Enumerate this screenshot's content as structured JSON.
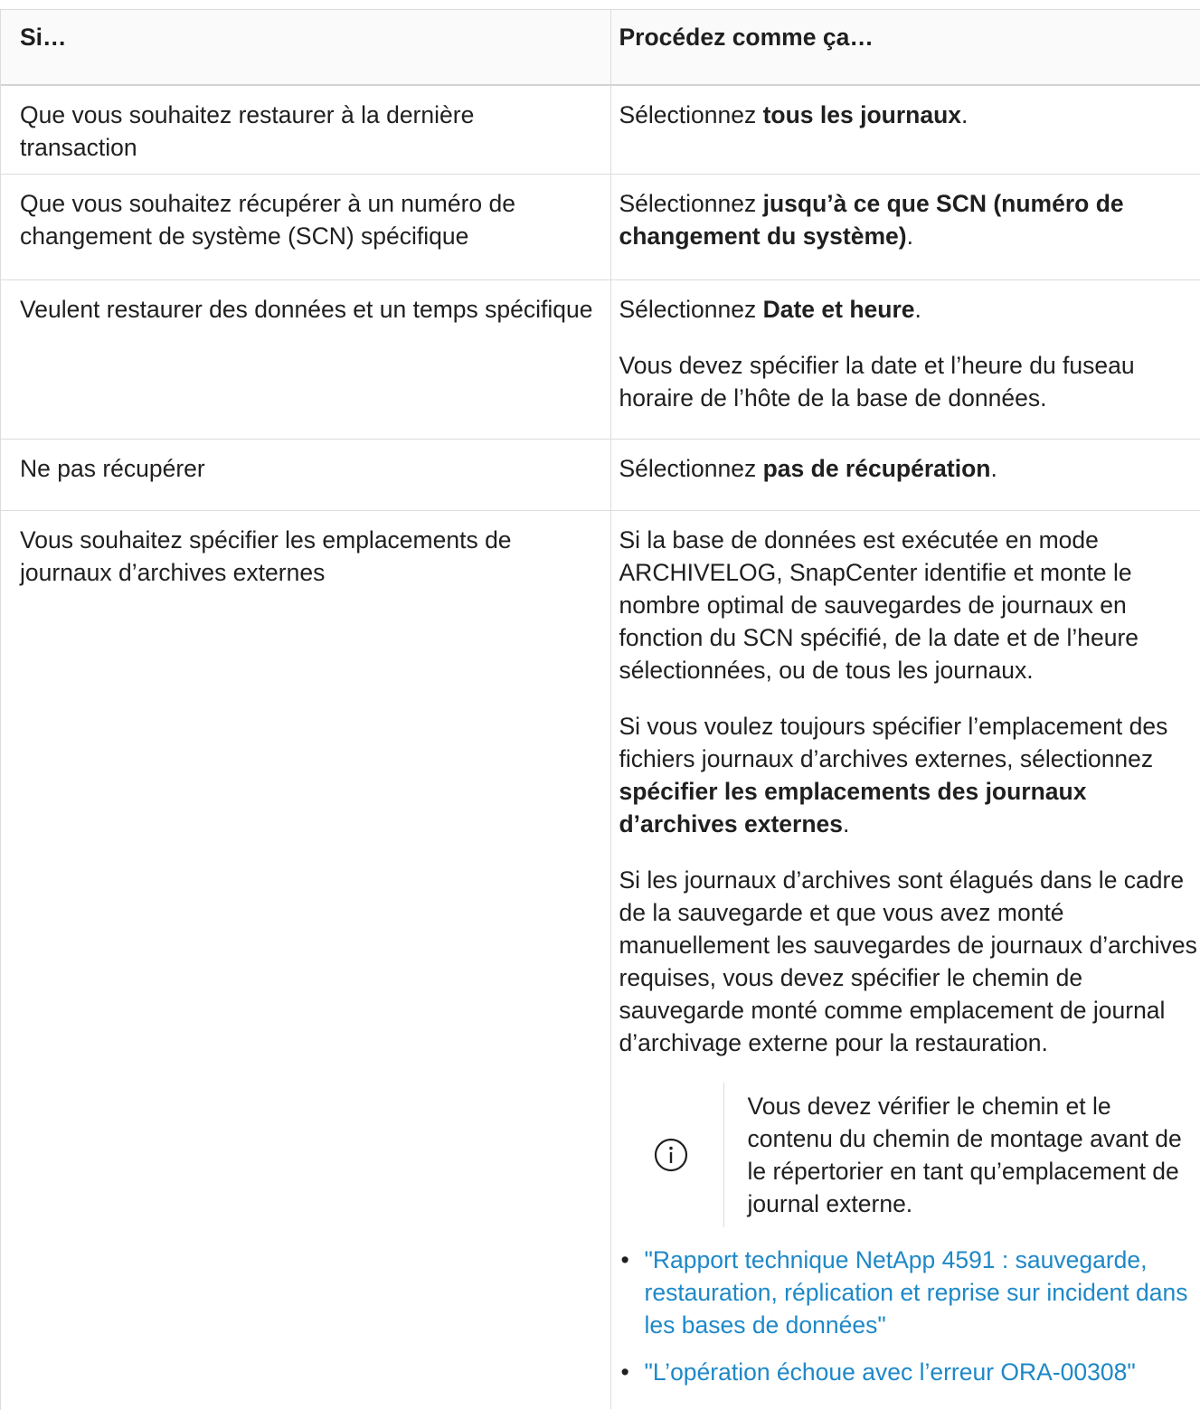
{
  "table": {
    "headers": [
      "Si…",
      "Procédez comme ça…"
    ],
    "rows": [
      {
        "condition": "Que vous souhaitez restaurer à la dernière transaction",
        "action_prefix": "Sélectionnez ",
        "action_bold": "tous les journaux",
        "action_suffix": "."
      },
      {
        "condition": "Que vous souhaitez récupérer à un numéro de changement de système (SCN) spécifique",
        "action_prefix": "Sélectionnez ",
        "action_bold": "jusqu’à ce que SCN (numéro de changement du système)",
        "action_suffix": "."
      },
      {
        "condition": "Veulent restaurer des données et un temps spécifique",
        "action_prefix": "Sélectionnez ",
        "action_bold": "Date et heure",
        "action_suffix": ".",
        "extra": "Vous devez spécifier la date et l’heure du fuseau horaire de l’hôte de la base de données."
      },
      {
        "condition": "Ne pas récupérer",
        "action_prefix": "Sélectionnez ",
        "action_bold": "pas de récupération",
        "action_suffix": "."
      },
      {
        "condition": "Vous souhaitez spécifier les emplacements de journaux d’archives externes",
        "para1": "Si la base de données est exécutée en mode ARCHIVELOG, SnapCenter identifie et monte le nombre optimal de sauvegardes de journaux en fonction du SCN spécifié, de la date et de l’heure sélectionnées, ou de tous les journaux.",
        "para2_prefix": "Si vous voulez toujours spécifier l’emplacement des fichiers journaux d’archives externes, sélectionnez ",
        "para2_bold": "spécifier les emplacements des journaux d’archives externes",
        "para2_suffix": ".",
        "para3": "Si les journaux d’archives sont élagués dans le cadre de la sauvegarde et que vous avez monté manuellement les sauvegardes de journaux d’archives requises, vous devez spécifier le chemin de sauvegarde monté comme emplacement de journal d’archivage externe pour la restauration.",
        "note": "Vous devez vérifier le chemin et le contenu du chemin de montage avant de le répertorier en tant qu’emplacement de journal externe.",
        "note_icon": "info-circle-icon",
        "links": [
          "\"Rapport technique NetApp 4591 : sauvegarde, restauration, réplication et reprise sur incident dans les bases de données\"",
          "\"L’opération échoue avec l’erreur ORA-00308\""
        ]
      }
    ]
  },
  "colors": {
    "link": "#1e88c7",
    "border": "#dcdcdc",
    "text": "#1f1f1f"
  }
}
